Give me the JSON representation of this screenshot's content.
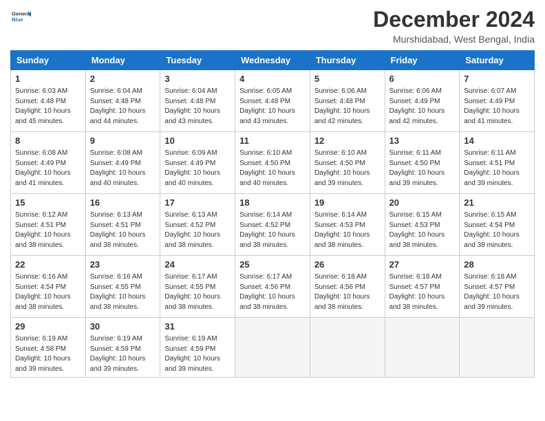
{
  "logo": {
    "line1": "General",
    "line2": "Blue"
  },
  "title": "December 2024",
  "location": "Murshidabad, West Bengal, India",
  "weekdays": [
    "Sunday",
    "Monday",
    "Tuesday",
    "Wednesday",
    "Thursday",
    "Friday",
    "Saturday"
  ],
  "weeks": [
    [
      {
        "day": "1",
        "sunrise": "6:03 AM",
        "sunset": "4:48 PM",
        "daylight": "10 hours and 45 minutes."
      },
      {
        "day": "2",
        "sunrise": "6:04 AM",
        "sunset": "4:48 PM",
        "daylight": "10 hours and 44 minutes."
      },
      {
        "day": "3",
        "sunrise": "6:04 AM",
        "sunset": "4:48 PM",
        "daylight": "10 hours and 43 minutes."
      },
      {
        "day": "4",
        "sunrise": "6:05 AM",
        "sunset": "4:48 PM",
        "daylight": "10 hours and 43 minutes."
      },
      {
        "day": "5",
        "sunrise": "6:06 AM",
        "sunset": "4:48 PM",
        "daylight": "10 hours and 42 minutes."
      },
      {
        "day": "6",
        "sunrise": "6:06 AM",
        "sunset": "4:49 PM",
        "daylight": "10 hours and 42 minutes."
      },
      {
        "day": "7",
        "sunrise": "6:07 AM",
        "sunset": "4:49 PM",
        "daylight": "10 hours and 41 minutes."
      }
    ],
    [
      {
        "day": "8",
        "sunrise": "6:08 AM",
        "sunset": "4:49 PM",
        "daylight": "10 hours and 41 minutes."
      },
      {
        "day": "9",
        "sunrise": "6:08 AM",
        "sunset": "4:49 PM",
        "daylight": "10 hours and 40 minutes."
      },
      {
        "day": "10",
        "sunrise": "6:09 AM",
        "sunset": "4:49 PM",
        "daylight": "10 hours and 40 minutes."
      },
      {
        "day": "11",
        "sunrise": "6:10 AM",
        "sunset": "4:50 PM",
        "daylight": "10 hours and 40 minutes."
      },
      {
        "day": "12",
        "sunrise": "6:10 AM",
        "sunset": "4:50 PM",
        "daylight": "10 hours and 39 minutes."
      },
      {
        "day": "13",
        "sunrise": "6:11 AM",
        "sunset": "4:50 PM",
        "daylight": "10 hours and 39 minutes."
      },
      {
        "day": "14",
        "sunrise": "6:11 AM",
        "sunset": "4:51 PM",
        "daylight": "10 hours and 39 minutes."
      }
    ],
    [
      {
        "day": "15",
        "sunrise": "6:12 AM",
        "sunset": "4:51 PM",
        "daylight": "10 hours and 38 minutes."
      },
      {
        "day": "16",
        "sunrise": "6:13 AM",
        "sunset": "4:51 PM",
        "daylight": "10 hours and 38 minutes."
      },
      {
        "day": "17",
        "sunrise": "6:13 AM",
        "sunset": "4:52 PM",
        "daylight": "10 hours and 38 minutes."
      },
      {
        "day": "18",
        "sunrise": "6:14 AM",
        "sunset": "4:52 PM",
        "daylight": "10 hours and 38 minutes."
      },
      {
        "day": "19",
        "sunrise": "6:14 AM",
        "sunset": "4:53 PM",
        "daylight": "10 hours and 38 minutes."
      },
      {
        "day": "20",
        "sunrise": "6:15 AM",
        "sunset": "4:53 PM",
        "daylight": "10 hours and 38 minutes."
      },
      {
        "day": "21",
        "sunrise": "6:15 AM",
        "sunset": "4:54 PM",
        "daylight": "10 hours and 38 minutes."
      }
    ],
    [
      {
        "day": "22",
        "sunrise": "6:16 AM",
        "sunset": "4:54 PM",
        "daylight": "10 hours and 38 minutes."
      },
      {
        "day": "23",
        "sunrise": "6:16 AM",
        "sunset": "4:55 PM",
        "daylight": "10 hours and 38 minutes."
      },
      {
        "day": "24",
        "sunrise": "6:17 AM",
        "sunset": "4:55 PM",
        "daylight": "10 hours and 38 minutes."
      },
      {
        "day": "25",
        "sunrise": "6:17 AM",
        "sunset": "4:56 PM",
        "daylight": "10 hours and 38 minutes."
      },
      {
        "day": "26",
        "sunrise": "6:18 AM",
        "sunset": "4:56 PM",
        "daylight": "10 hours and 38 minutes."
      },
      {
        "day": "27",
        "sunrise": "6:18 AM",
        "sunset": "4:57 PM",
        "daylight": "10 hours and 38 minutes."
      },
      {
        "day": "28",
        "sunrise": "6:18 AM",
        "sunset": "4:57 PM",
        "daylight": "10 hours and 39 minutes."
      }
    ],
    [
      {
        "day": "29",
        "sunrise": "6:19 AM",
        "sunset": "4:58 PM",
        "daylight": "10 hours and 39 minutes."
      },
      {
        "day": "30",
        "sunrise": "6:19 AM",
        "sunset": "4:59 PM",
        "daylight": "10 hours and 39 minutes."
      },
      {
        "day": "31",
        "sunrise": "6:19 AM",
        "sunset": "4:59 PM",
        "daylight": "10 hours and 39 minutes."
      },
      null,
      null,
      null,
      null
    ]
  ]
}
